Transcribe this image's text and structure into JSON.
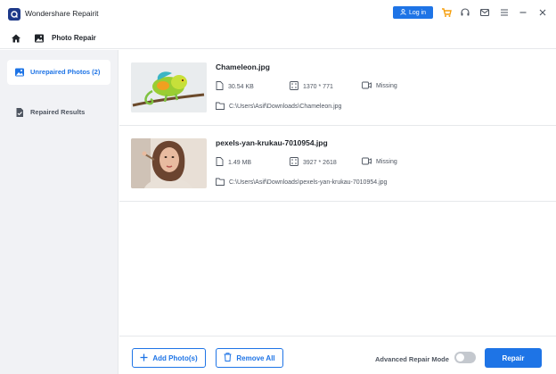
{
  "app": {
    "title": "Wondershare Repairit",
    "login_label": "Log in"
  },
  "nav": {
    "title": "Photo Repair"
  },
  "sidebar": {
    "items": [
      {
        "label": "Unrepaired Photos (2)",
        "active": true
      },
      {
        "label": "Repaired Results",
        "active": false
      }
    ]
  },
  "files": [
    {
      "name": "Chameleon.jpg",
      "size": "30.54  KB",
      "resolution": "1370 * 771",
      "status": "Missing",
      "path": "C:\\Users\\Asif\\Downloads\\Chameleon.jpg"
    },
    {
      "name": "pexels-yan-krukau-7010954.jpg",
      "size": "1.49  MB",
      "resolution": "3927 * 2618",
      "status": "Missing",
      "path": "C:\\Users\\Asif\\Downloads\\pexels-yan-krukau-7010954.jpg"
    }
  ],
  "footer": {
    "add_label": "Add Photo(s)",
    "remove_label": "Remove All",
    "advanced_label": "Advanced Repair Mode",
    "advanced_on": false,
    "repair_label": "Repair"
  },
  "colors": {
    "accent": "#1e74e6",
    "cart": "#f59e0b",
    "sidebar_bg": "#f1f2f5"
  },
  "icons": [
    "app-logo-icon",
    "user-icon",
    "cart-icon",
    "headset-icon",
    "mail-icon",
    "menu-icon",
    "minimize-icon",
    "close-icon",
    "home-icon",
    "photo-icon",
    "result-icon",
    "file-icon",
    "resolution-icon",
    "video-icon",
    "folder-icon",
    "plus-icon",
    "trash-icon"
  ]
}
